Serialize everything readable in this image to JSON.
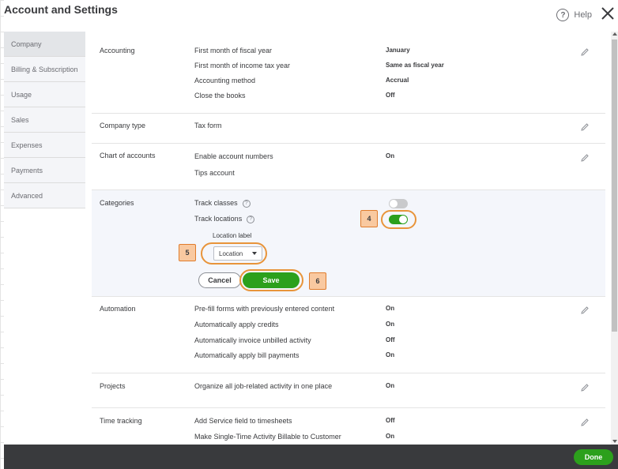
{
  "header": {
    "title": "Account and Settings",
    "help_label": "Help",
    "help_icon": "?"
  },
  "sidebar": {
    "items": [
      {
        "label": "Company",
        "active": true
      },
      {
        "label": "Billing & Subscription"
      },
      {
        "label": "Usage"
      },
      {
        "label": "Sales"
      },
      {
        "label": "Expenses"
      },
      {
        "label": "Payments"
      },
      {
        "label": "Advanced"
      }
    ]
  },
  "accounting": {
    "title": "Accounting",
    "rows": [
      {
        "label": "First month of fiscal year",
        "value": "January"
      },
      {
        "label": "First month of income tax year",
        "value": "Same as fiscal year"
      },
      {
        "label": "Accounting method",
        "value": "Accrual"
      },
      {
        "label": "Close the books",
        "value": "Off"
      }
    ]
  },
  "company_type": {
    "title": "Company type",
    "rows": [
      {
        "label": "Tax form"
      }
    ]
  },
  "chart_of_accounts": {
    "title": "Chart of accounts",
    "rows": [
      {
        "label": "Enable account numbers",
        "value": "On"
      },
      {
        "label": "Tips account"
      }
    ]
  },
  "categories": {
    "title": "Categories",
    "track_classes": {
      "label": "Track classes",
      "on": false
    },
    "track_locations": {
      "label": "Track locations",
      "on": true
    },
    "location_label": {
      "label": "Location label",
      "value": "Location"
    },
    "cancel_label": "Cancel",
    "save_label": "Save",
    "qmark": "?"
  },
  "callouts": {
    "c4": "4",
    "c5": "5",
    "c6": "6"
  },
  "automation": {
    "title": "Automation",
    "rows": [
      {
        "label": "Pre-fill forms with previously entered content",
        "value": "On"
      },
      {
        "label": "Automatically apply credits",
        "value": "On"
      },
      {
        "label": "Automatically invoice unbilled activity",
        "value": "Off"
      },
      {
        "label": "Automatically apply bill payments",
        "value": "On"
      }
    ]
  },
  "projects": {
    "title": "Projects",
    "rows": [
      {
        "label": "Organize all job-related activity in one place",
        "value": "On"
      }
    ]
  },
  "time_tracking": {
    "title": "Time tracking",
    "rows": [
      {
        "label": "Add Service field to timesheets",
        "value": "Off"
      },
      {
        "label": "Make Single-Time Activity Billable to Customer",
        "value": "On"
      }
    ]
  },
  "footer": {
    "done_label": "Done"
  },
  "colors": {
    "accent_green": "#2ca01c",
    "callout_orange": "#e8943a",
    "footer_bg": "#393a3d"
  }
}
